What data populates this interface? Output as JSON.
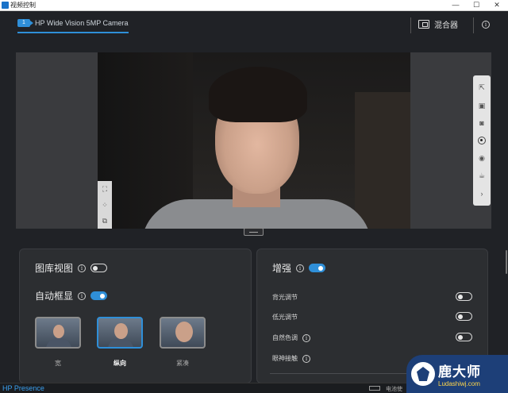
{
  "window": {
    "title": "视频控制",
    "controls": [
      "—",
      "☐",
      "✕"
    ]
  },
  "header": {
    "camera_badge": "1",
    "camera_name": "HP Wide Vision 5MP Camera",
    "mixer_label": "混合器"
  },
  "preview": {
    "left_tools": [
      "crop-icon",
      "focus-icon",
      "copy-icon"
    ],
    "right_tools": [
      "popout-icon",
      "snapshot-folder-icon",
      "camera-icon",
      "record-icon",
      "broadcast-icon",
      "mug-icon",
      "chevron-right-icon"
    ]
  },
  "gallery_panel": {
    "gallery_view_label": "图库视图",
    "gallery_view_on": false,
    "auto_frame_label": "自动框显",
    "auto_frame_on": true,
    "modes": [
      "宽",
      "纵向",
      "紧凑"
    ],
    "selected_mode": "纵向"
  },
  "enhance_panel": {
    "title": "增强",
    "enabled": true,
    "items": [
      {
        "label": "背光调节",
        "on": false
      },
      {
        "label": "低光调节",
        "on": false
      },
      {
        "label": "自然色调",
        "on": false
      },
      {
        "label": "眼神接触",
        "on": false
      }
    ]
  },
  "statusbar": {
    "brand": "HP Presence",
    "battery_text": "电池使"
  },
  "watermark": {
    "main": "鹿大师",
    "sub": "Ludashiwj.com"
  },
  "colors": {
    "accent": "#2f8fd8",
    "background": "#202226",
    "panel": "#2c2e31"
  }
}
